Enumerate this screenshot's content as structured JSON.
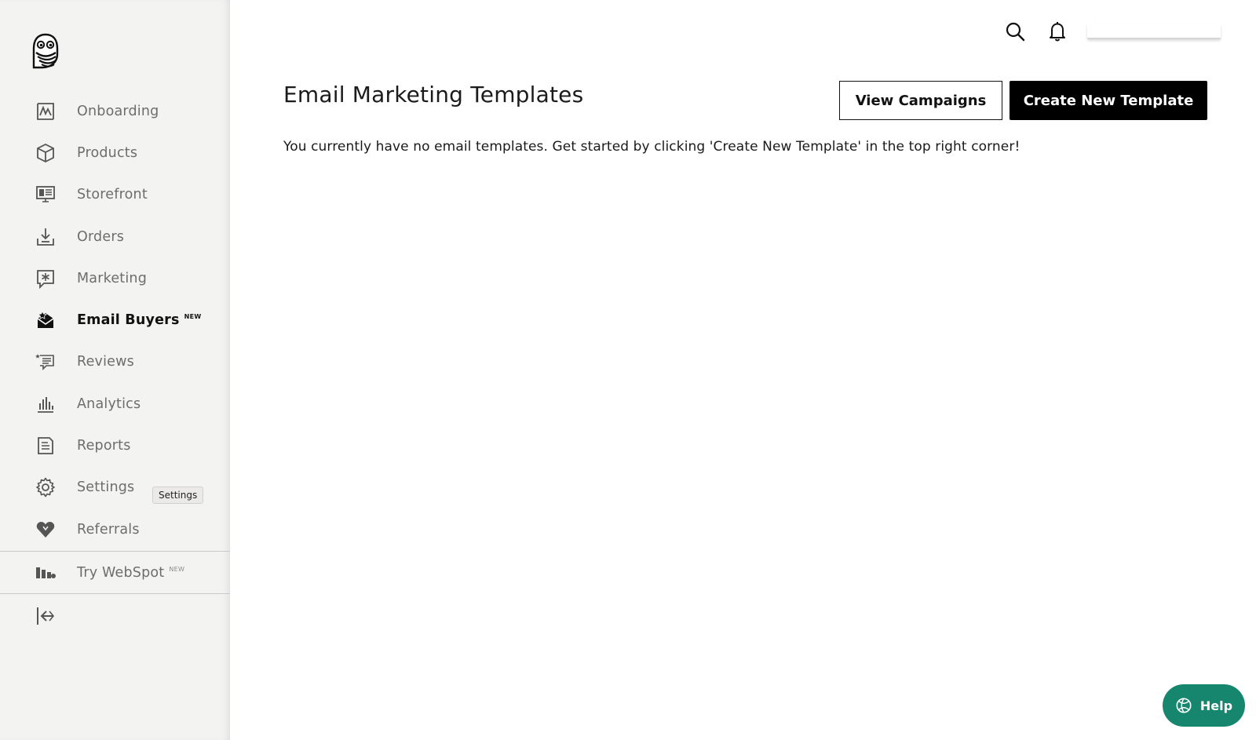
{
  "sidebar": {
    "items": [
      {
        "label": "Onboarding",
        "icon": "chart-frame-icon"
      },
      {
        "label": "Products",
        "icon": "box-icon"
      },
      {
        "label": "Storefront",
        "icon": "monitor-icon"
      },
      {
        "label": "Orders",
        "icon": "download-tray-icon"
      },
      {
        "label": "Marketing",
        "icon": "star-message-icon"
      },
      {
        "label": "Email Buyers",
        "icon": "envelope-icon",
        "badge": "NEW",
        "active": true
      },
      {
        "label": "Reviews",
        "icon": "review-list-icon"
      },
      {
        "label": "Analytics",
        "icon": "bar-chart-icon"
      },
      {
        "label": "Reports",
        "icon": "document-icon"
      },
      {
        "label": "Settings",
        "icon": "gear-icon"
      },
      {
        "label": "Referrals",
        "icon": "heart-tag-icon"
      }
    ],
    "tooltip": "Settings",
    "webspot": {
      "label": "Try WebSpot",
      "badge": "NEW"
    }
  },
  "header": {
    "search_icon": "search-icon",
    "notifications_icon": "bell-icon"
  },
  "main": {
    "title": "Email Marketing Templates",
    "view_campaigns_label": "View Campaigns",
    "create_template_label": "Create New Template",
    "empty_message": "You currently have no email templates. Get started by clicking 'Create New Template' in the top right corner!"
  },
  "help": {
    "label": "Help"
  },
  "colors": {
    "help_bg": "#17866e",
    "sidebar_bg": "#f3f3f2",
    "primary_button": "#000000"
  }
}
